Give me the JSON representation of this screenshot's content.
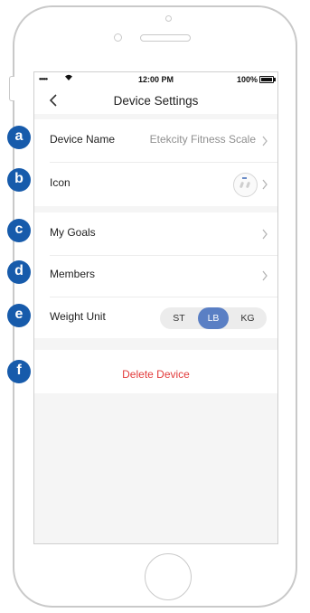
{
  "status_bar": {
    "signal": "•••••",
    "time": "12:00 PM",
    "battery": "100%"
  },
  "nav": {
    "title": "Device Settings",
    "back_icon": "chevron-left-icon"
  },
  "rows": {
    "device_name": {
      "label": "Device Name",
      "value": "Etekcity Fitness Scale"
    },
    "icon": {
      "label": "Icon"
    },
    "my_goals": {
      "label": "My Goals"
    },
    "members": {
      "label": "Members"
    },
    "weight_unit": {
      "label": "Weight Unit",
      "options": [
        "ST",
        "LB",
        "KG"
      ],
      "selected": "LB"
    }
  },
  "delete_label": "Delete Device",
  "callouts": [
    "a",
    "b",
    "c",
    "d",
    "e",
    "f"
  ],
  "colors": {
    "accent": "#5a7fc4",
    "badge": "#175bab",
    "danger": "#e23b3b"
  }
}
